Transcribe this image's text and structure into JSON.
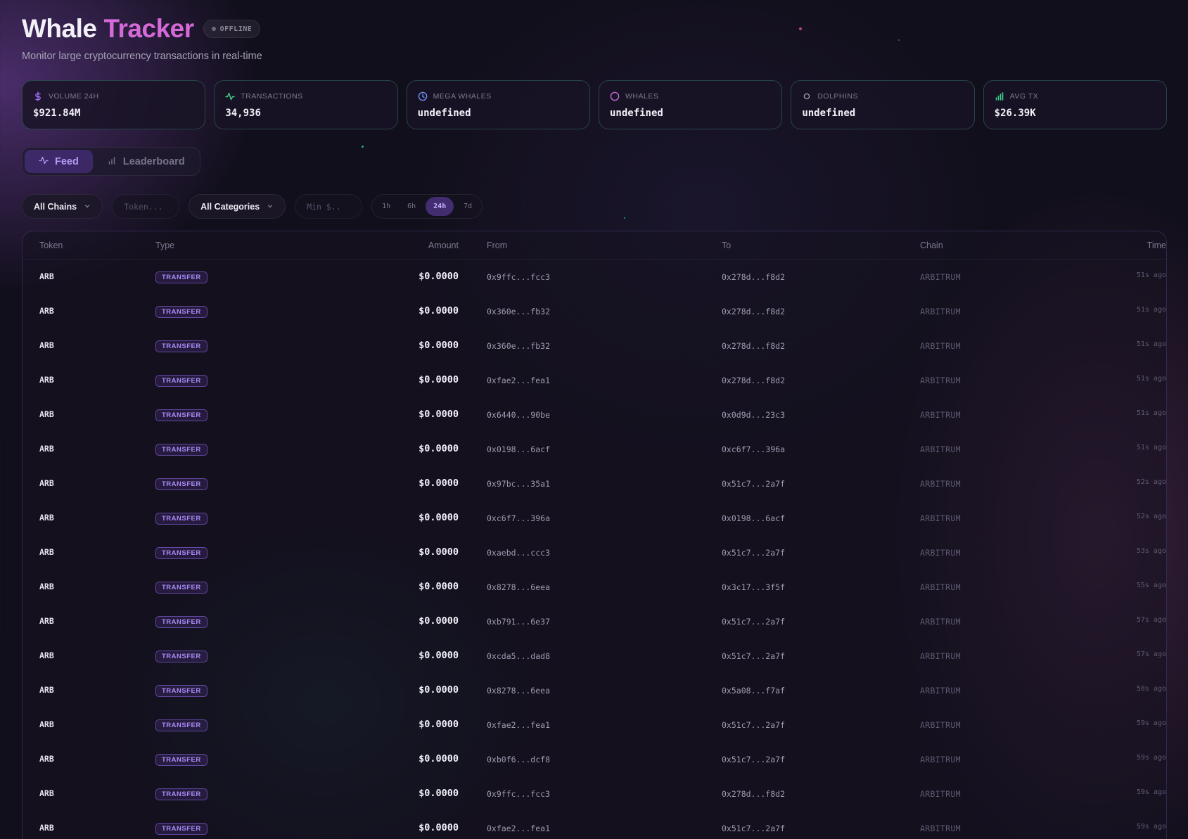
{
  "header": {
    "title_part1": "Whale",
    "title_part2": "Tracker",
    "status": "OFFLINE",
    "subtitle": "Monitor large cryptocurrency transactions in real-time"
  },
  "stats": [
    {
      "label": "VOLUME 24H",
      "value": "$921.84M",
      "icon": "dollar-icon",
      "color": "#9a6df0"
    },
    {
      "label": "TRANSACTIONS",
      "value": "34,936",
      "icon": "activity-icon",
      "color": "#3fd08a"
    },
    {
      "label": "MEGA WHALES",
      "value": "undefined",
      "icon": "clock-icon",
      "color": "#6f8ff0"
    },
    {
      "label": "WHALES",
      "value": "undefined",
      "icon": "circle-icon",
      "color": "#c46ad8"
    },
    {
      "label": "DOLPHINS",
      "value": "undefined",
      "icon": "small-circle-icon",
      "color": "#a7a3b6"
    },
    {
      "label": "AVG TX",
      "value": "$26.39K",
      "icon": "bar-chart-icon",
      "color": "#3fd08a"
    }
  ],
  "tabs": [
    {
      "label": "Feed",
      "icon": "activity-icon",
      "active": true
    },
    {
      "label": "Leaderboard",
      "icon": "bar-chart-icon",
      "active": false
    }
  ],
  "filters": {
    "chain_select": "All Chains",
    "token_placeholder": "Token...",
    "category_select": "All Categories",
    "min_placeholder": "Min $..",
    "time_ranges": [
      "1h",
      "6h",
      "24h",
      "7d"
    ],
    "active_time_range": "24h"
  },
  "table": {
    "columns": [
      "Token",
      "Type",
      "Amount",
      "From",
      "To",
      "Chain",
      "Time"
    ],
    "rows": [
      {
        "token": "ARB",
        "type": "TRANSFER",
        "amount": "$0.0000",
        "from": "0x9ffc...fcc3",
        "to": "0x278d...f8d2",
        "chain": "ARBITRUM",
        "time": "51s ago"
      },
      {
        "token": "ARB",
        "type": "TRANSFER",
        "amount": "$0.0000",
        "from": "0x360e...fb32",
        "to": "0x278d...f8d2",
        "chain": "ARBITRUM",
        "time": "51s ago"
      },
      {
        "token": "ARB",
        "type": "TRANSFER",
        "amount": "$0.0000",
        "from": "0x360e...fb32",
        "to": "0x278d...f8d2",
        "chain": "ARBITRUM",
        "time": "51s ago"
      },
      {
        "token": "ARB",
        "type": "TRANSFER",
        "amount": "$0.0000",
        "from": "0xfae2...fea1",
        "to": "0x278d...f8d2",
        "chain": "ARBITRUM",
        "time": "51s ago"
      },
      {
        "token": "ARB",
        "type": "TRANSFER",
        "amount": "$0.0000",
        "from": "0x6440...90be",
        "to": "0x0d9d...23c3",
        "chain": "ARBITRUM",
        "time": "51s ago"
      },
      {
        "token": "ARB",
        "type": "TRANSFER",
        "amount": "$0.0000",
        "from": "0x0198...6acf",
        "to": "0xc6f7...396a",
        "chain": "ARBITRUM",
        "time": "51s ago"
      },
      {
        "token": "ARB",
        "type": "TRANSFER",
        "amount": "$0.0000",
        "from": "0x97bc...35a1",
        "to": "0x51c7...2a7f",
        "chain": "ARBITRUM",
        "time": "52s ago"
      },
      {
        "token": "ARB",
        "type": "TRANSFER",
        "amount": "$0.0000",
        "from": "0xc6f7...396a",
        "to": "0x0198...6acf",
        "chain": "ARBITRUM",
        "time": "52s ago"
      },
      {
        "token": "ARB",
        "type": "TRANSFER",
        "amount": "$0.0000",
        "from": "0xaebd...ccc3",
        "to": "0x51c7...2a7f",
        "chain": "ARBITRUM",
        "time": "53s ago"
      },
      {
        "token": "ARB",
        "type": "TRANSFER",
        "amount": "$0.0000",
        "from": "0x8278...6eea",
        "to": "0x3c17...3f5f",
        "chain": "ARBITRUM",
        "time": "55s ago"
      },
      {
        "token": "ARB",
        "type": "TRANSFER",
        "amount": "$0.0000",
        "from": "0xb791...6e37",
        "to": "0x51c7...2a7f",
        "chain": "ARBITRUM",
        "time": "57s ago"
      },
      {
        "token": "ARB",
        "type": "TRANSFER",
        "amount": "$0.0000",
        "from": "0xcda5...dad8",
        "to": "0x51c7...2a7f",
        "chain": "ARBITRUM",
        "time": "57s ago"
      },
      {
        "token": "ARB",
        "type": "TRANSFER",
        "amount": "$0.0000",
        "from": "0x8278...6eea",
        "to": "0x5a08...f7af",
        "chain": "ARBITRUM",
        "time": "58s ago"
      },
      {
        "token": "ARB",
        "type": "TRANSFER",
        "amount": "$0.0000",
        "from": "0xfae2...fea1",
        "to": "0x51c7...2a7f",
        "chain": "ARBITRUM",
        "time": "59s ago"
      },
      {
        "token": "ARB",
        "type": "TRANSFER",
        "amount": "$0.0000",
        "from": "0xb0f6...dcf8",
        "to": "0x51c7...2a7f",
        "chain": "ARBITRUM",
        "time": "59s ago"
      },
      {
        "token": "ARB",
        "type": "TRANSFER",
        "amount": "$0.0000",
        "from": "0x9ffc...fcc3",
        "to": "0x278d...f8d2",
        "chain": "ARBITRUM",
        "time": "59s ago"
      },
      {
        "token": "ARB",
        "type": "TRANSFER",
        "amount": "$0.0000",
        "from": "0xfae2...fea1",
        "to": "0x51c7...2a7f",
        "chain": "ARBITRUM",
        "time": "59s ago"
      }
    ]
  },
  "colors": {
    "accent_purple": "#9a6df0",
    "title_pink": "#d46ad8",
    "background": "#120f1c"
  }
}
